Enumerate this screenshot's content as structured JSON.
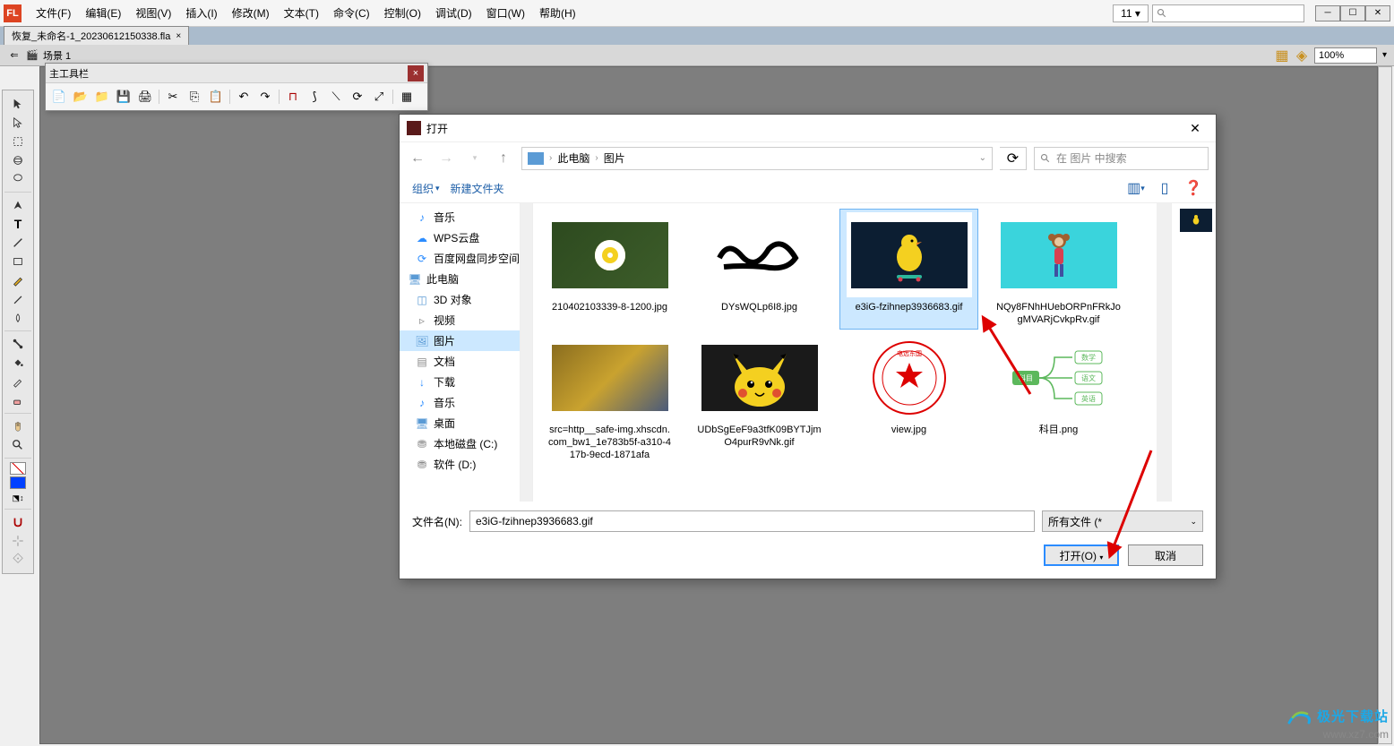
{
  "menubar": {
    "app": "FL",
    "items": [
      "文件(F)",
      "编辑(E)",
      "视图(V)",
      "插入(I)",
      "修改(M)",
      "文本(T)",
      "命令(C)",
      "控制(O)",
      "调试(D)",
      "窗口(W)",
      "帮助(H)"
    ],
    "zoom_small": "11"
  },
  "doc_tab": {
    "name": "恢复_未命名-1_20230612150338.fla"
  },
  "scene": {
    "name": "场景 1",
    "zoom": "100%"
  },
  "floating_toolbar": {
    "title": "主工具栏"
  },
  "dialog": {
    "title": "打开",
    "breadcrumb": {
      "root": "此电脑",
      "folder": "图片"
    },
    "search_placeholder": "在 图片 中搜索",
    "organize": "组织",
    "new_folder": "新建文件夹",
    "sidebar": [
      "音乐",
      "WPS云盘",
      "百度网盘同步空间",
      "此电脑",
      "3D 对象",
      "视频",
      "图片",
      "文档",
      "下载",
      "音乐",
      "桌面",
      "本地磁盘 (C:)",
      "软件 (D:)"
    ],
    "files": [
      {
        "name": "210402103339-8-1200.jpg"
      },
      {
        "name": "DYsWQLp6I8.jpg"
      },
      {
        "name": "e3iG-fzihnep3936683.gif"
      },
      {
        "name": "NQy8FNhHUebORPnFRkJogMVARjCvkpRv.gif"
      },
      {
        "name": "src=http__safe-img.xhscdn.com_bw1_1e783b5f-a310-417b-9ecd-1871afa"
      },
      {
        "name": "UDbSgEeF9a3tfK09BYTJjmO4purR9vNk.gif"
      },
      {
        "name": "view.jpg"
      },
      {
        "name": "科目.png"
      }
    ],
    "filename_label": "文件名(N):",
    "filename_value": "e3iG-fzihnep3936683.gif",
    "filetype": "所有文件 (*",
    "open_btn": "打开(O)",
    "cancel_btn": "取消"
  },
  "diagram": {
    "center": "科目",
    "top": "数学",
    "mid": "语文",
    "bot": "英语"
  },
  "watermark": {
    "line1": "极光下载站",
    "line2": "www.xz7.com"
  }
}
